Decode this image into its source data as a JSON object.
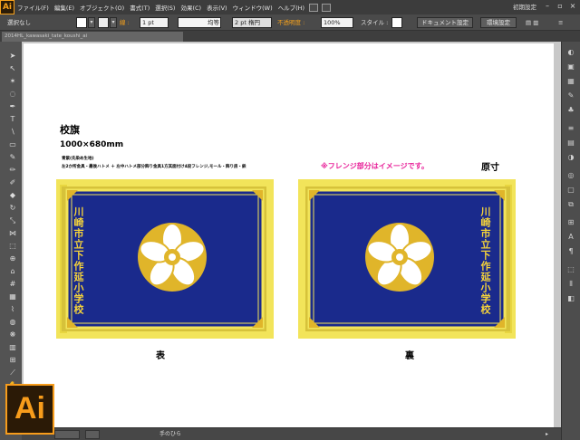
{
  "app": {
    "logo": "Ai",
    "essentials": "初期設定"
  },
  "menu": [
    "ファイル(F)",
    "編集(E)",
    "オブジェクト(O)",
    "書式(T)",
    "選択(S)",
    "効果(C)",
    "表示(V)",
    "ウィンドウ(W)",
    "ヘルプ(H)"
  ],
  "control": {
    "selection": "選択なし",
    "stroke_label": "線 :",
    "stroke_weight": "1 pt",
    "profile": "均等",
    "brush": "2 pt 楕円",
    "opacity_label": "不透明度 :",
    "opacity": "100%",
    "style_label": "スタイル :",
    "doc_setup": "ドキュメント設定",
    "prefs": "環境設定"
  },
  "document_tab": "2014HL_kawasaki_tate_koushi_ai",
  "status": {
    "tool": "手のひら"
  },
  "artwork": {
    "title": "校旗",
    "size": "1000×680mm",
    "note1": "青紫(先染め生地)",
    "note2": "左2か所金具・最後ハトメ ＋ 左中ハトメ部分飾り金具1方其面付け4段フレンジ,モール・飾り房・鋲",
    "flange_note": "※フレンジ部分はイメージです。",
    "scale": "原寸",
    "front_label": "表",
    "back_label": "裏",
    "school_name": "川崎市立下作延小学校"
  },
  "colors": {
    "flag_blue": "#1a2a8c",
    "fringe_yellow": "#f2e45a",
    "emblem_gold": "#e0b52a",
    "flange_pink": "#e8249a",
    "ai_orange": "#f79c1b"
  }
}
